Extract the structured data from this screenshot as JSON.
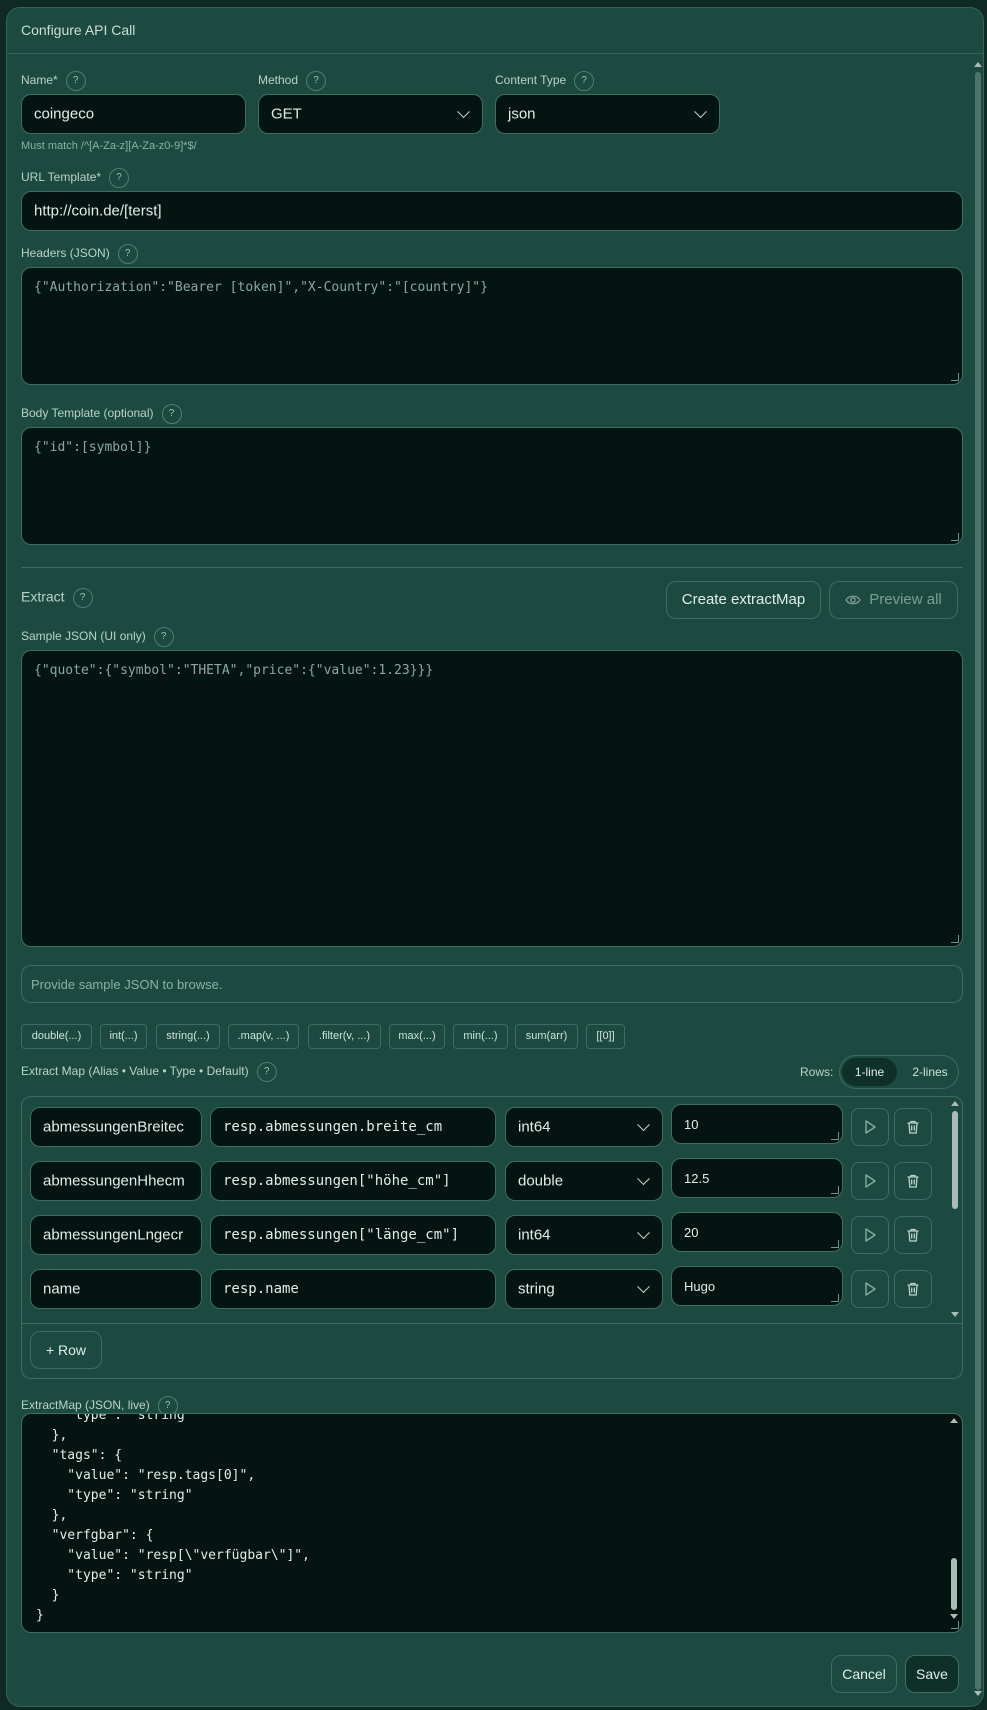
{
  "dialog": {
    "title": "Configure API Call"
  },
  "name": {
    "label": "Name*",
    "value": "coingeco",
    "hint": "Must match /^[A-Za-z][A-Za-z0-9]*$/"
  },
  "method": {
    "label": "Method",
    "value": "GET"
  },
  "content_type": {
    "label": "Content Type",
    "value": "json"
  },
  "url": {
    "label": "URL Template*",
    "value": "http://coin.de/[terst]"
  },
  "headers": {
    "label": "Headers (JSON)",
    "placeholder": "{\"Authorization\":\"Bearer [token]\",\"X-Country\":\"[country]\"}"
  },
  "body": {
    "label": "Body Template (optional)",
    "placeholder": "{\"id\":[symbol]}"
  },
  "extract": {
    "label": "Extract",
    "create_button": "Create extractMap",
    "preview_button": "Preview all",
    "sample_label": "Sample JSON (UI only)",
    "sample_placeholder": "{\"quote\":{\"symbol\":\"THETA\",\"price\":{\"value\":1.23}}}",
    "browse_hint": "Provide sample JSON to browse."
  },
  "chips": [
    "double(...)",
    "int(...)",
    "string(...)",
    ".map(v, ...)",
    ".filter(v, ...)",
    "max(...)",
    "min(...)",
    "sum(arr)",
    "[[0]]"
  ],
  "extract_map": {
    "label": "Extract Map (Alias • Value • Type • Default)",
    "rows_label": "Rows:",
    "toggle": [
      "1-line",
      "2-lines"
    ],
    "rows": [
      {
        "alias": "abmessungenBreitec",
        "value": "resp.abmessungen.breite_cm",
        "type": "int64",
        "default": "10"
      },
      {
        "alias": "abmessungenHhecm",
        "value": "resp.abmessungen[\"höhe_cm\"]",
        "type": "double",
        "default": "12.5"
      },
      {
        "alias": "abmessungenLngecr",
        "value": "resp.abmessungen[\"länge_cm\"]",
        "type": "int64",
        "default": "20"
      },
      {
        "alias": "name",
        "value": "resp.name",
        "type": "string",
        "default": "Hugo"
      }
    ],
    "add_row": "+ Row"
  },
  "extract_json": {
    "label": "ExtractMap (JSON, live)",
    "lines": [
      "    \"type\": \"string\"",
      "  },",
      "  \"tags\": {",
      "    \"value\": \"resp.tags[0]\",",
      "    \"type\": \"string\"",
      "  },",
      "  \"verfgbar\": {",
      "    \"value\": \"resp[\\\"verfügbar\\\"]\",",
      "    \"type\": \"string\"",
      "  }",
      "}"
    ]
  },
  "footer": {
    "cancel": "Cancel",
    "save": "Save"
  },
  "help_glyph": "?",
  "icons": {
    "run": "play-icon",
    "delete": "trash-icon",
    "preview": "eye-icon"
  }
}
